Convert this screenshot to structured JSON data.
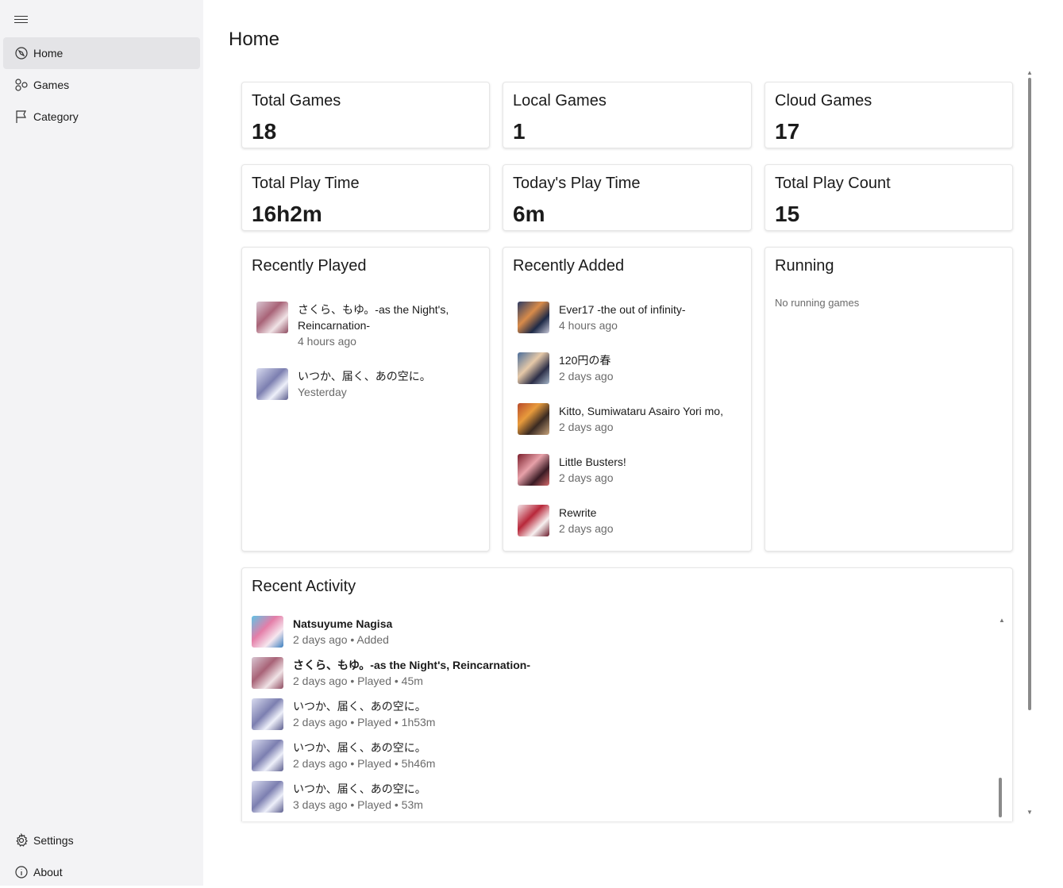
{
  "page": {
    "title": "Home"
  },
  "sidebar": {
    "items": [
      {
        "label": "Home",
        "icon": "home-compass-icon",
        "active": true
      },
      {
        "label": "Games",
        "icon": "games-icon",
        "active": false
      },
      {
        "label": "Category",
        "icon": "flag-icon",
        "active": false
      }
    ],
    "footer": [
      {
        "label": "Settings",
        "icon": "gear-icon"
      },
      {
        "label": "About",
        "icon": "info-icon"
      }
    ]
  },
  "stats": [
    {
      "title": "Total Games",
      "value": "18"
    },
    {
      "title": "Local Games",
      "value": "1"
    },
    {
      "title": "Cloud Games",
      "value": "17"
    },
    {
      "title": "Total Play Time",
      "value": "16h2m"
    },
    {
      "title": "Today's Play Time",
      "value": "6m"
    },
    {
      "title": "Total Play Count",
      "value": "15"
    }
  ],
  "recently_played": {
    "title": "Recently Played",
    "items": [
      {
        "title": "さくら、もゆ。-as the Night's,",
        "title2": "Reincarnation-",
        "sub": "4 hours ago"
      },
      {
        "title": "いつか、届く、あの空に。",
        "sub": "Yesterday"
      }
    ]
  },
  "recently_added": {
    "title": "Recently Added",
    "items": [
      {
        "title": "Ever17 -the out of infinity-",
        "sub": "4 hours ago"
      },
      {
        "title": "120円の春",
        "sub": "2 days ago"
      },
      {
        "title": "Kitto, Sumiwataru Asairo Yori mo,",
        "sub": "2 days ago"
      },
      {
        "title": "Little Busters!",
        "sub": "2 days ago"
      },
      {
        "title": "Rewrite",
        "sub": "2 days ago"
      }
    ]
  },
  "running": {
    "title": "Running",
    "empty": "No running games"
  },
  "recent_activity": {
    "title": "Recent Activity",
    "items": [
      {
        "title": "Natsuyume Nagisa",
        "sub": "2 days ago • Added"
      },
      {
        "title": "さくら、もゆ。-as the Night's, Reincarnation-",
        "sub": "2 days ago • Played • 45m"
      },
      {
        "title": "いつか、届く、あの空に。",
        "sub": "2 days ago • Played • 1h53m"
      },
      {
        "title": "いつか、届く、あの空に。",
        "sub": "2 days ago • Played • 5h46m"
      },
      {
        "title": "いつか、届く、あの空に。",
        "sub": "3 days ago • Played • 53m"
      }
    ]
  }
}
